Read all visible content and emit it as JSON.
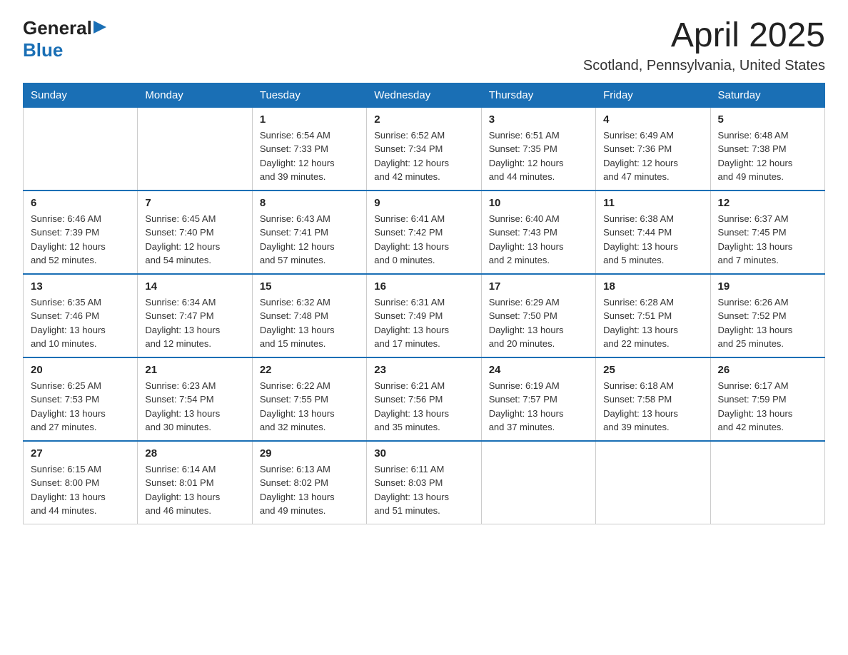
{
  "header": {
    "logo_general": "General",
    "logo_blue": "Blue",
    "month_title": "April 2025",
    "location": "Scotland, Pennsylvania, United States"
  },
  "weekdays": [
    "Sunday",
    "Monday",
    "Tuesday",
    "Wednesday",
    "Thursday",
    "Friday",
    "Saturday"
  ],
  "weeks": [
    [
      {
        "day": "",
        "info": ""
      },
      {
        "day": "",
        "info": ""
      },
      {
        "day": "1",
        "info": "Sunrise: 6:54 AM\nSunset: 7:33 PM\nDaylight: 12 hours\nand 39 minutes."
      },
      {
        "day": "2",
        "info": "Sunrise: 6:52 AM\nSunset: 7:34 PM\nDaylight: 12 hours\nand 42 minutes."
      },
      {
        "day": "3",
        "info": "Sunrise: 6:51 AM\nSunset: 7:35 PM\nDaylight: 12 hours\nand 44 minutes."
      },
      {
        "day": "4",
        "info": "Sunrise: 6:49 AM\nSunset: 7:36 PM\nDaylight: 12 hours\nand 47 minutes."
      },
      {
        "day": "5",
        "info": "Sunrise: 6:48 AM\nSunset: 7:38 PM\nDaylight: 12 hours\nand 49 minutes."
      }
    ],
    [
      {
        "day": "6",
        "info": "Sunrise: 6:46 AM\nSunset: 7:39 PM\nDaylight: 12 hours\nand 52 minutes."
      },
      {
        "day": "7",
        "info": "Sunrise: 6:45 AM\nSunset: 7:40 PM\nDaylight: 12 hours\nand 54 minutes."
      },
      {
        "day": "8",
        "info": "Sunrise: 6:43 AM\nSunset: 7:41 PM\nDaylight: 12 hours\nand 57 minutes."
      },
      {
        "day": "9",
        "info": "Sunrise: 6:41 AM\nSunset: 7:42 PM\nDaylight: 13 hours\nand 0 minutes."
      },
      {
        "day": "10",
        "info": "Sunrise: 6:40 AM\nSunset: 7:43 PM\nDaylight: 13 hours\nand 2 minutes."
      },
      {
        "day": "11",
        "info": "Sunrise: 6:38 AM\nSunset: 7:44 PM\nDaylight: 13 hours\nand 5 minutes."
      },
      {
        "day": "12",
        "info": "Sunrise: 6:37 AM\nSunset: 7:45 PM\nDaylight: 13 hours\nand 7 minutes."
      }
    ],
    [
      {
        "day": "13",
        "info": "Sunrise: 6:35 AM\nSunset: 7:46 PM\nDaylight: 13 hours\nand 10 minutes."
      },
      {
        "day": "14",
        "info": "Sunrise: 6:34 AM\nSunset: 7:47 PM\nDaylight: 13 hours\nand 12 minutes."
      },
      {
        "day": "15",
        "info": "Sunrise: 6:32 AM\nSunset: 7:48 PM\nDaylight: 13 hours\nand 15 minutes."
      },
      {
        "day": "16",
        "info": "Sunrise: 6:31 AM\nSunset: 7:49 PM\nDaylight: 13 hours\nand 17 minutes."
      },
      {
        "day": "17",
        "info": "Sunrise: 6:29 AM\nSunset: 7:50 PM\nDaylight: 13 hours\nand 20 minutes."
      },
      {
        "day": "18",
        "info": "Sunrise: 6:28 AM\nSunset: 7:51 PM\nDaylight: 13 hours\nand 22 minutes."
      },
      {
        "day": "19",
        "info": "Sunrise: 6:26 AM\nSunset: 7:52 PM\nDaylight: 13 hours\nand 25 minutes."
      }
    ],
    [
      {
        "day": "20",
        "info": "Sunrise: 6:25 AM\nSunset: 7:53 PM\nDaylight: 13 hours\nand 27 minutes."
      },
      {
        "day": "21",
        "info": "Sunrise: 6:23 AM\nSunset: 7:54 PM\nDaylight: 13 hours\nand 30 minutes."
      },
      {
        "day": "22",
        "info": "Sunrise: 6:22 AM\nSunset: 7:55 PM\nDaylight: 13 hours\nand 32 minutes."
      },
      {
        "day": "23",
        "info": "Sunrise: 6:21 AM\nSunset: 7:56 PM\nDaylight: 13 hours\nand 35 minutes."
      },
      {
        "day": "24",
        "info": "Sunrise: 6:19 AM\nSunset: 7:57 PM\nDaylight: 13 hours\nand 37 minutes."
      },
      {
        "day": "25",
        "info": "Sunrise: 6:18 AM\nSunset: 7:58 PM\nDaylight: 13 hours\nand 39 minutes."
      },
      {
        "day": "26",
        "info": "Sunrise: 6:17 AM\nSunset: 7:59 PM\nDaylight: 13 hours\nand 42 minutes."
      }
    ],
    [
      {
        "day": "27",
        "info": "Sunrise: 6:15 AM\nSunset: 8:00 PM\nDaylight: 13 hours\nand 44 minutes."
      },
      {
        "day": "28",
        "info": "Sunrise: 6:14 AM\nSunset: 8:01 PM\nDaylight: 13 hours\nand 46 minutes."
      },
      {
        "day": "29",
        "info": "Sunrise: 6:13 AM\nSunset: 8:02 PM\nDaylight: 13 hours\nand 49 minutes."
      },
      {
        "day": "30",
        "info": "Sunrise: 6:11 AM\nSunset: 8:03 PM\nDaylight: 13 hours\nand 51 minutes."
      },
      {
        "day": "",
        "info": ""
      },
      {
        "day": "",
        "info": ""
      },
      {
        "day": "",
        "info": ""
      }
    ]
  ]
}
